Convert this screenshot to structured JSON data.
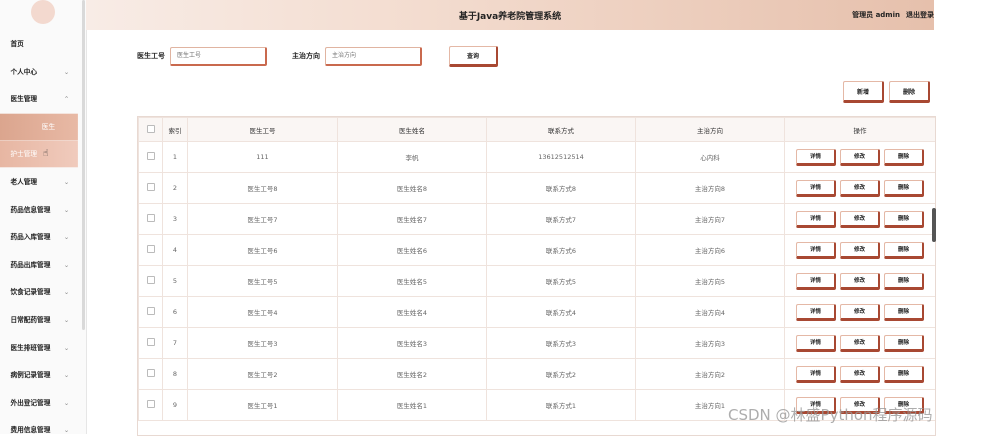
{
  "header": {
    "title": "基于Java养老院管理系统",
    "user_label": "管理员 admin",
    "logout_label": "退出登录"
  },
  "sidebar": {
    "items": [
      {
        "label": "首页",
        "chevron": ""
      },
      {
        "label": "个人中心",
        "chevron": "⌄"
      },
      {
        "label": "医生管理",
        "chevron": "⌃"
      },
      {
        "label": "医生",
        "chevron": ""
      },
      {
        "label": "护士管理",
        "chevron": ""
      },
      {
        "label": "老人管理",
        "chevron": "⌄"
      },
      {
        "label": "药品信息管理",
        "chevron": "⌄"
      },
      {
        "label": "药品入库管理",
        "chevron": "⌄"
      },
      {
        "label": "药品出库管理",
        "chevron": "⌄"
      },
      {
        "label": "饮食记录管理",
        "chevron": "⌄"
      },
      {
        "label": "日常配药管理",
        "chevron": "⌄"
      },
      {
        "label": "医生排班管理",
        "chevron": "⌄"
      },
      {
        "label": "病例记录管理",
        "chevron": "⌄"
      },
      {
        "label": "外出登记管理",
        "chevron": "⌄"
      },
      {
        "label": "费用信息管理",
        "chevron": "⌄"
      }
    ]
  },
  "search": {
    "field1_label": "医生工号",
    "field1_placeholder": "医生工号",
    "field2_label": "主治方向",
    "field2_placeholder": "主治方向",
    "query_label": "查询"
  },
  "actions": {
    "add_label": "新增",
    "delete_label": "删除"
  },
  "table": {
    "headers": [
      "索引",
      "医生工号",
      "医生姓名",
      "联系方式",
      "主治方向",
      "操作"
    ],
    "op_labels": {
      "detail": "详情",
      "edit": "修改",
      "delete": "删除"
    },
    "rows": [
      [
        "1",
        "111",
        "李帆",
        "13612512514",
        "心内科"
      ],
      [
        "2",
        "医生工号8",
        "医生姓名8",
        "联系方式8",
        "主治方向8"
      ],
      [
        "3",
        "医生工号7",
        "医生姓名7",
        "联系方式7",
        "主治方向7"
      ],
      [
        "4",
        "医生工号6",
        "医生姓名6",
        "联系方式6",
        "主治方向6"
      ],
      [
        "5",
        "医生工号5",
        "医生姓名5",
        "联系方式5",
        "主治方向5"
      ],
      [
        "6",
        "医生工号4",
        "医生姓名4",
        "联系方式4",
        "主治方向4"
      ],
      [
        "7",
        "医生工号3",
        "医生姓名3",
        "联系方式3",
        "主治方向3"
      ],
      [
        "8",
        "医生工号2",
        "医生姓名2",
        "联系方式2",
        "主治方向2"
      ],
      [
        "9",
        "医生工号1",
        "医生姓名1",
        "联系方式1",
        "主治方向1"
      ]
    ]
  },
  "watermark": "CSDN @林盛Python程序源码",
  "colors": {
    "accent": "#a84832",
    "header_gradient_end": "#e6c0ac",
    "active_menu": "#dba58e"
  }
}
